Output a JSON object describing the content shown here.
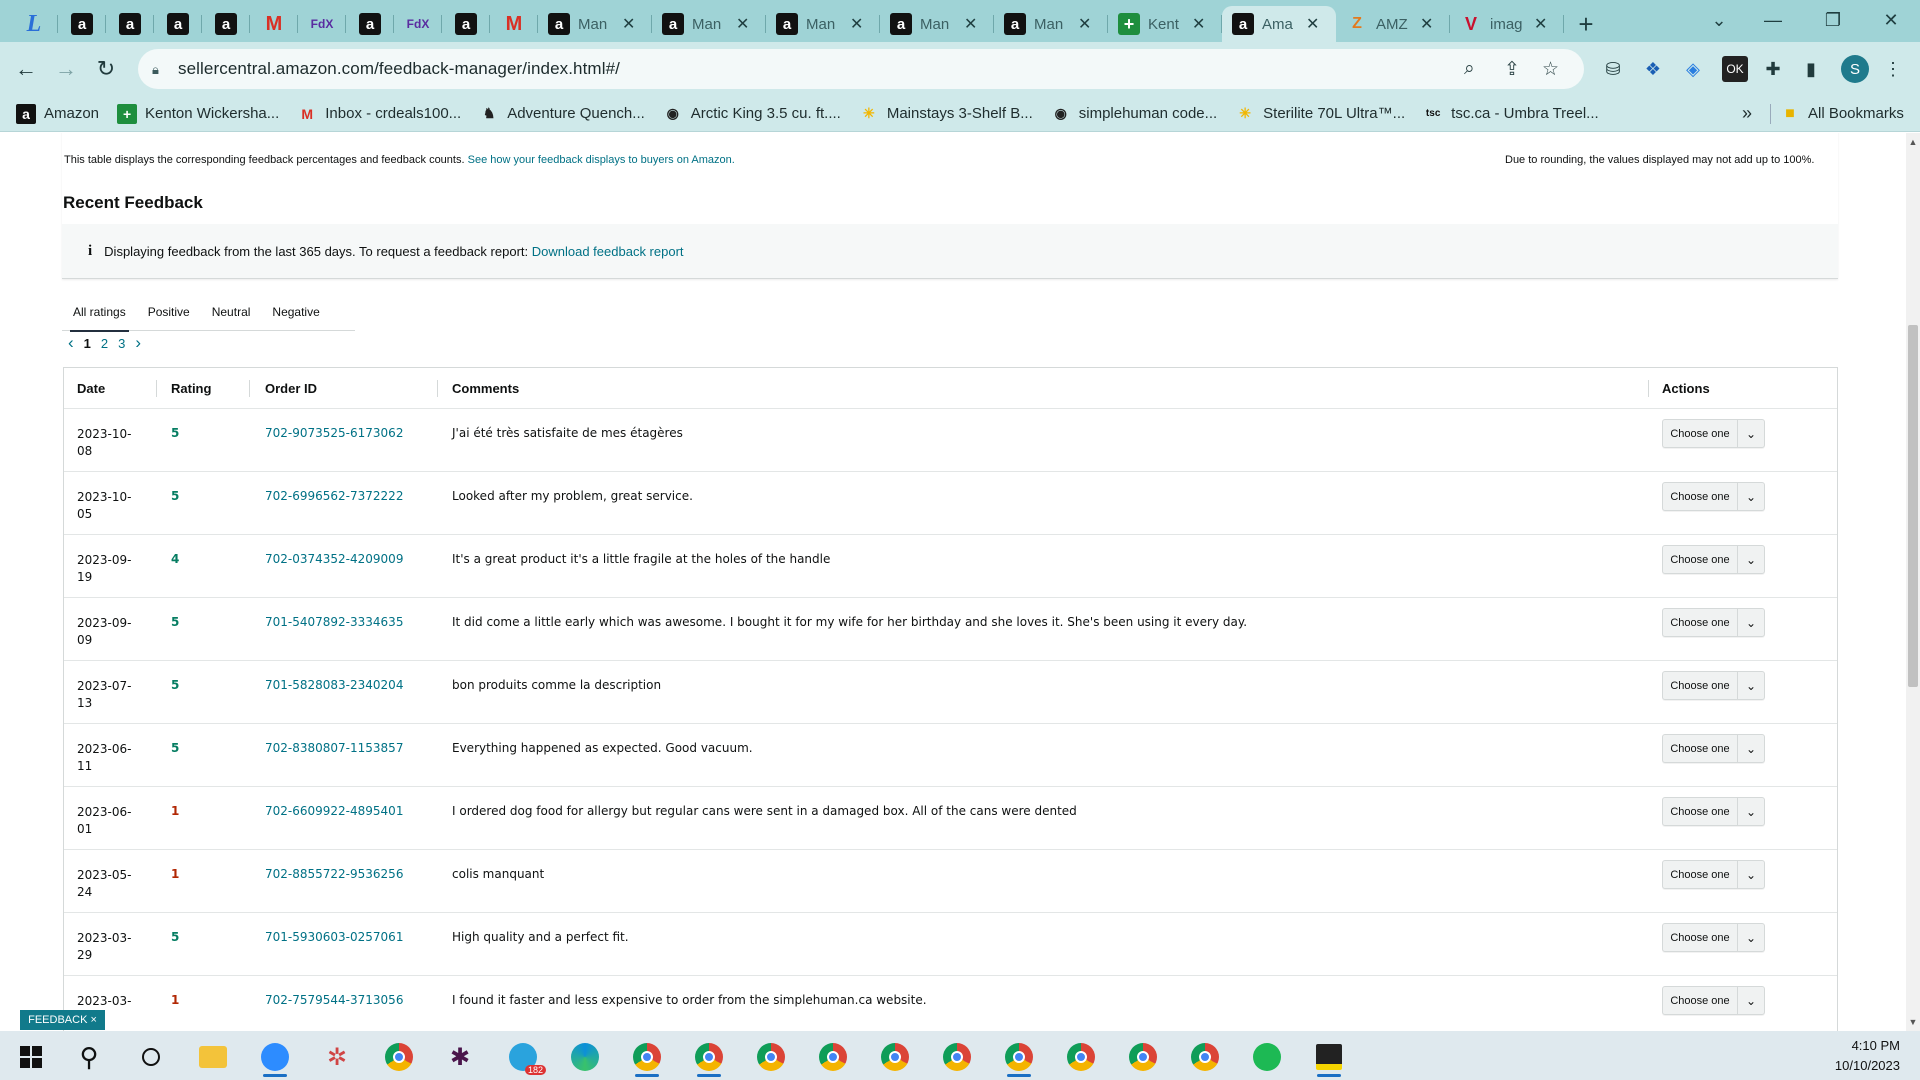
{
  "browser": {
    "tabs": [
      {
        "type": "small",
        "icon": "lt",
        "glyph": "L"
      },
      {
        "type": "small",
        "icon": "amz",
        "glyph": "a"
      },
      {
        "type": "small",
        "icon": "amz",
        "glyph": "a"
      },
      {
        "type": "small",
        "icon": "amz",
        "glyph": "a"
      },
      {
        "type": "small",
        "icon": "amz",
        "glyph": "a"
      },
      {
        "type": "small",
        "icon": "gm",
        "glyph": "M"
      },
      {
        "type": "small",
        "icon": "fx",
        "glyph": "FdX"
      },
      {
        "type": "small",
        "icon": "amz",
        "glyph": "a"
      },
      {
        "type": "small",
        "icon": "fx",
        "glyph": "FdX"
      },
      {
        "type": "small",
        "icon": "amz",
        "glyph": "a"
      },
      {
        "type": "small",
        "icon": "gm",
        "glyph": "M"
      },
      {
        "type": "wide",
        "icon": "amz",
        "glyph": "a",
        "title": "Man"
      },
      {
        "type": "wide",
        "icon": "amz",
        "glyph": "a",
        "title": "Man"
      },
      {
        "type": "wide",
        "icon": "amz",
        "glyph": "a",
        "title": "Man"
      },
      {
        "type": "wide",
        "icon": "amz",
        "glyph": "a",
        "title": "Man"
      },
      {
        "type": "wide",
        "icon": "amz",
        "glyph": "a",
        "title": "Man"
      },
      {
        "type": "wide",
        "icon": "sheet",
        "glyph": "+",
        "title": "Kent"
      },
      {
        "type": "wide",
        "icon": "amz",
        "glyph": "a",
        "title": "Ama",
        "active": true
      },
      {
        "type": "wide",
        "icon": "amz2",
        "glyph": "Z",
        "title": "AMZ"
      },
      {
        "type": "wide",
        "icon": "v",
        "glyph": "V",
        "title": "imag"
      }
    ],
    "url": "sellercentral.amazon.com/feedback-manager/index.html#/",
    "profile_initial": "S",
    "bookmarks": [
      {
        "label": "Amazon",
        "icon": "a",
        "bg": "#111",
        "fg": "#fff"
      },
      {
        "label": "Kenton Wickersha...",
        "icon": "+",
        "bg": "#1e8e3e",
        "fg": "#fff"
      },
      {
        "label": "Inbox - crdeals100...",
        "icon": "M",
        "bg": "transparent",
        "fg": "#d93025"
      },
      {
        "label": "Adventure Quench...",
        "icon": "♞",
        "bg": "transparent",
        "fg": "#222"
      },
      {
        "label": "Arctic King 3.5 cu. ft....",
        "icon": "◉",
        "bg": "transparent",
        "fg": "#222"
      },
      {
        "label": "Mainstays 3-Shelf B...",
        "icon": "✳",
        "bg": "transparent",
        "fg": "#f2b600"
      },
      {
        "label": "simplehuman code...",
        "icon": "◉",
        "bg": "transparent",
        "fg": "#222"
      },
      {
        "label": "Sterilite 70L Ultra™...",
        "icon": "✳",
        "bg": "transparent",
        "fg": "#f2b600"
      },
      {
        "label": "tsc.ca - Umbra Treel...",
        "icon": "tsc",
        "bg": "transparent",
        "fg": "#111"
      }
    ],
    "bookmarks_more": "»",
    "all_bookmarks": "All Bookmarks"
  },
  "page": {
    "table_note": "This table displays the corresponding feedback percentages and feedback counts.",
    "table_note_link": "See how your feedback displays to buyers on Amazon.",
    "rounding_note": "Due to rounding, the values displayed may not add up to 100%.",
    "section_title": "Recent Feedback",
    "info_icon": "i",
    "info_text": "Displaying feedback from the last 365 days. To request a feedback report:",
    "info_link": "Download feedback report",
    "filter_tabs": [
      "All ratings",
      "Positive",
      "Neutral",
      "Negative"
    ],
    "active_filter": 0,
    "pages": [
      "1",
      "2",
      "3"
    ],
    "current_page": 0,
    "columns": {
      "date": "Date",
      "rating": "Rating",
      "order": "Order ID",
      "comments": "Comments",
      "actions": "Actions"
    },
    "rows": [
      {
        "date_a": "2023-10-",
        "date_b": "08",
        "rating": "5",
        "order": "702-9073525-6173062",
        "comment": "J'ai été très satisfaite de mes étagères"
      },
      {
        "date_a": "2023-10-",
        "date_b": "05",
        "rating": "5",
        "order": "702-6996562-7372222",
        "comment": "Looked after my problem, great service."
      },
      {
        "date_a": "2023-09-",
        "date_b": "19",
        "rating": "4",
        "order": "702-0374352-4209009",
        "comment": "It's a great product it's a little fragile at the holes of the handle"
      },
      {
        "date_a": "2023-09-",
        "date_b": "09",
        "rating": "5",
        "order": "701-5407892-3334635",
        "comment": "It did come a little early which was awesome. I bought it for my wife for her birthday and she loves it. She's been using it every day."
      },
      {
        "date_a": "2023-07-",
        "date_b": "13",
        "rating": "5",
        "order": "701-5828083-2340204",
        "comment": "bon produits comme la description"
      },
      {
        "date_a": "2023-06-",
        "date_b": "11",
        "rating": "5",
        "order": "702-8380807-1153857",
        "comment": "Everything happened as expected. Good vacuum."
      },
      {
        "date_a": "2023-06-",
        "date_b": "01",
        "rating": "1",
        "order": "702-6609922-4895401",
        "comment": "I ordered dog food for allergy but regular cans were sent in a damaged box. All of the cans were dented"
      },
      {
        "date_a": "2023-05-",
        "date_b": "24",
        "rating": "1",
        "order": "702-8855722-9536256",
        "comment": "colis manquant"
      },
      {
        "date_a": "2023-03-",
        "date_b": "29",
        "rating": "5",
        "order": "701-5930603-0257061",
        "comment": "High quality and a perfect fit."
      },
      {
        "date_a": "2023-03-",
        "date_b": "",
        "rating": "1",
        "order": "702-7579544-3713056",
        "comment": "I found it faster and less expensive to order from the simplehuman.ca website."
      }
    ],
    "action_label": "Choose one",
    "feedback_badge": "FEEDBACK ×",
    "colors": {
      "positive": "#067d62",
      "negative": "#b12704",
      "link": "#007185"
    }
  },
  "taskbar": {
    "time": "4:10 PM",
    "date": "10/10/2023",
    "telegram_badge": "182"
  }
}
